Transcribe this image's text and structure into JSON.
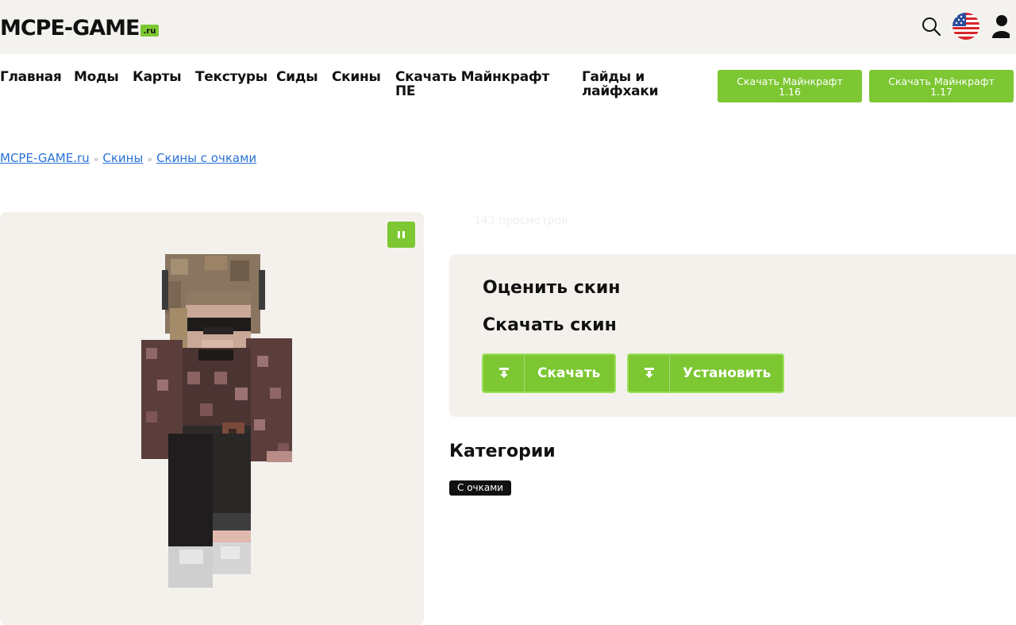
{
  "header": {
    "logo_text": "MCPE-GAME",
    "logo_suffix": ".ru",
    "icons": [
      "search-icon",
      "us-flag-icon",
      "user-icon"
    ]
  },
  "nav": {
    "items": [
      "Главная",
      "Моды",
      "Карты",
      "Текстуры",
      "Сиды",
      "Скины",
      "Скачать Майнкрафт ПЕ",
      "Гайды и лайфхаки"
    ],
    "buttons": [
      {
        "line1": "Скачать Майнкрафт",
        "line2": "1.16"
      },
      {
        "line1": "Скачать Майнкрафт",
        "line2": "1.17"
      }
    ]
  },
  "breadcrumb": {
    "items": [
      "MCPE-GAME.ru",
      "Скины",
      "Скины с очками"
    ],
    "separator": "»"
  },
  "skin": {
    "views": "143 просмотров",
    "controls": [
      "pause-icon"
    ]
  },
  "rate": {
    "title": "Оценить скин",
    "download_title": "Скачать скин",
    "download_button": "Скачать",
    "install_button": "Установить"
  },
  "categories": {
    "title": "Категории",
    "tags": [
      "С очками"
    ]
  },
  "colors": {
    "accent": "#7cc732",
    "link": "#2a72d6",
    "panel": "#f4f1ed",
    "header_bg": "#f4f2ee"
  }
}
